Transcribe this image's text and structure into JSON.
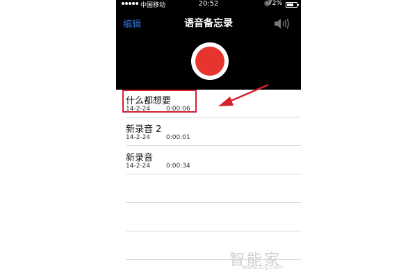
{
  "status_bar": {
    "carrier": "中国移动",
    "time": "20:52",
    "battery_percent": "72%",
    "battery_level": 0.72
  },
  "nav": {
    "edit_label": "编辑",
    "title": "语音备忘录",
    "speaker_icon": "speaker-icon"
  },
  "record_button": {
    "icon": "record-icon",
    "color": "#e8342e"
  },
  "recordings": [
    {
      "title": "什么都想要",
      "date": "14-2-24",
      "duration": "0:00:06"
    },
    {
      "title": "新录音 2",
      "date": "14-2-24",
      "duration": "0:00:01"
    },
    {
      "title": "新录音",
      "date": "14-2-24",
      "duration": "0:00:34"
    }
  ],
  "annotation": {
    "highlight_color": "#d6202c"
  },
  "watermark": {
    "logo": "智能家",
    "url": "www.znj.com"
  }
}
